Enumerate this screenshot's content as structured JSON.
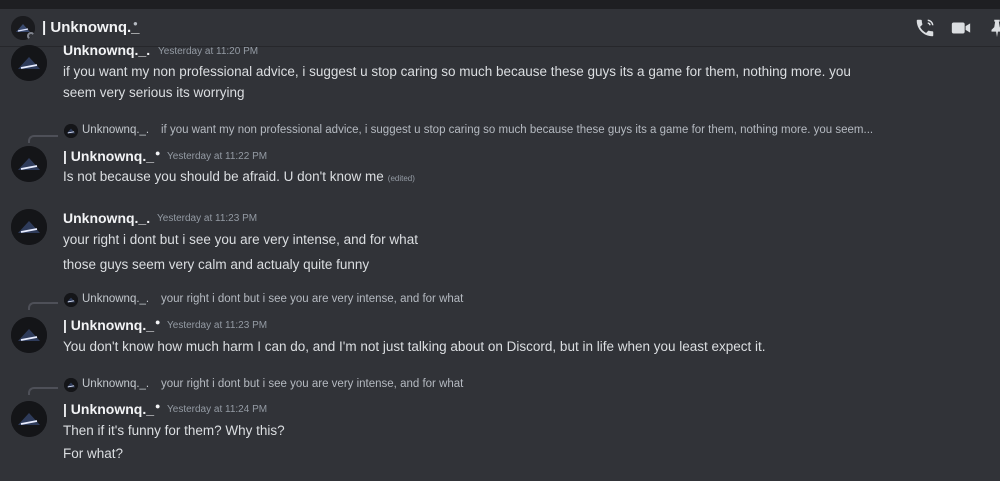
{
  "header": {
    "title": "| Unknownq._",
    "status_dot": "●",
    "icons": [
      "phone-call-icon",
      "video-call-icon",
      "pin-icon"
    ]
  },
  "messages": [
    {
      "username": "Unknownq._.",
      "timestamp": "Yesterday at 11:20 PM",
      "lines": [
        "if you want my non professional advice, i suggest u stop caring so much because these guys its a game for them, nothing more. you",
        "seem very serious its worrying"
      ]
    },
    {
      "reply": {
        "username": "Unknownq._.",
        "text": "if you want my non professional advice, i suggest u stop caring so much because these guys its a game for them, nothing more. you seem..."
      },
      "username": "| Unknownq._",
      "crown": "●",
      "timestamp": "Yesterday at 11:22 PM",
      "lines": [
        "Is not because you should be afraid. U don't know me"
      ],
      "edited": "(edited)"
    },
    {
      "username": "Unknownq._.",
      "timestamp": "Yesterday at 11:23 PM",
      "lines": [
        "your right i dont but i see you are very intense, and for what",
        "those guys seem very calm and actualy quite funny"
      ]
    },
    {
      "reply": {
        "username": "Unknownq._.",
        "text": "your right i dont but i see you are very intense, and for what"
      },
      "username": "| Unknownq._",
      "crown": "●",
      "timestamp": "Yesterday at 11:23 PM",
      "lines": [
        "You don't know how much harm I can do, and I'm not just talking about on Discord, but in life when you least expect it."
      ]
    },
    {
      "reply": {
        "username": "Unknownq._.",
        "text": "your right i dont but i see you are very intense, and for what"
      },
      "username": "| Unknownq._",
      "crown": "●",
      "timestamp": "Yesterday at 11:24 PM",
      "lines": [
        "Then if it's funny for them? Why  this?",
        "For what?"
      ]
    }
  ]
}
